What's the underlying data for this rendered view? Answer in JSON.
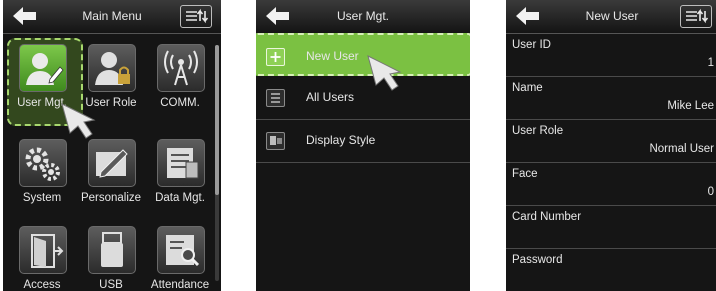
{
  "main_menu": {
    "title": "Main Menu",
    "items": [
      {
        "label": "User Mgt.",
        "icon": "user-edit-icon"
      },
      {
        "label": "User Role",
        "icon": "user-lock-icon"
      },
      {
        "label": "COMM.",
        "icon": "antenna-icon"
      },
      {
        "label": "System",
        "icon": "gears-icon"
      },
      {
        "label": "Personalize",
        "icon": "pen-icon"
      },
      {
        "label": "Data Mgt.",
        "icon": "database-icon"
      },
      {
        "label": "Access",
        "icon": "door-icon"
      },
      {
        "label": "USB",
        "icon": "usb-drive-icon"
      },
      {
        "label": "Attendance",
        "icon": "report-search-icon"
      }
    ],
    "selected": "User Mgt."
  },
  "user_mgt": {
    "title": "User Mgt.",
    "items": [
      {
        "label": "New User",
        "icon": "plus-icon"
      },
      {
        "label": "All Users",
        "icon": "list-icon"
      },
      {
        "label": "Display Style",
        "icon": "display-icon"
      }
    ],
    "selected": "New User"
  },
  "new_user": {
    "title": "New User",
    "fields": [
      {
        "label": "User ID",
        "value": "1"
      },
      {
        "label": "Name",
        "value": "Mike Lee"
      },
      {
        "label": "User Role",
        "value": "Normal User"
      },
      {
        "label": "Face",
        "value": "0"
      },
      {
        "label": "Card Number",
        "value": ""
      },
      {
        "label": "Password",
        "value": ""
      }
    ]
  },
  "colors": {
    "highlight": "#7bc142",
    "background": "#151515",
    "titlebar": "#2a2a2a"
  }
}
